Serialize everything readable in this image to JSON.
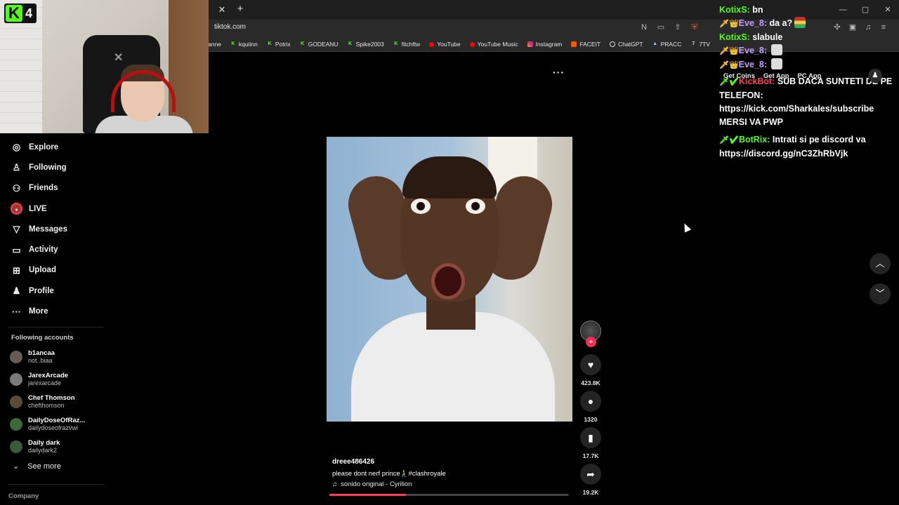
{
  "browser": {
    "url": "tiktok.com",
    "close_tab_glyph": "✕",
    "new_tab_glyph": "+",
    "bookmarks": [
      {
        "label": "anne",
        "icon": "none"
      },
      {
        "label": "kquiinn",
        "icon": "kick"
      },
      {
        "label": "Potrix",
        "icon": "kick"
      },
      {
        "label": "GODEANU",
        "icon": "kick"
      },
      {
        "label": "Spike2003",
        "icon": "kick"
      },
      {
        "label": "fitchftw",
        "icon": "kick"
      },
      {
        "label": "YouTube",
        "icon": "youtube"
      },
      {
        "label": "YouTube Music",
        "icon": "youtube"
      },
      {
        "label": "Instagram",
        "icon": "instagram"
      },
      {
        "label": "FACEIT",
        "icon": "faceit"
      },
      {
        "label": "ChatGPT",
        "icon": "chatgpt"
      },
      {
        "label": "PRACC",
        "icon": "pracc"
      },
      {
        "label": "7TV",
        "icon": "7tv"
      }
    ]
  },
  "overlay": {
    "kick_logo": "K",
    "kick_number": "4"
  },
  "sidebar": {
    "nav": [
      {
        "label": "Explore",
        "icon": "compass-icon",
        "glyph": "◎"
      },
      {
        "label": "Following",
        "icon": "person-icon",
        "glyph": "♙"
      },
      {
        "label": "Friends",
        "icon": "friends-icon",
        "glyph": "⚇"
      },
      {
        "label": "LIVE",
        "icon": "live-icon",
        "glyph": "●"
      },
      {
        "label": "Messages",
        "icon": "paper-plane-icon",
        "glyph": "▽"
      },
      {
        "label": "Activity",
        "icon": "inbox-icon",
        "glyph": "▭"
      },
      {
        "label": "Upload",
        "icon": "plus-square-icon",
        "glyph": "⊞"
      },
      {
        "label": "Profile",
        "icon": "profile-icon",
        "glyph": "♟"
      },
      {
        "label": "More",
        "icon": "ellipsis-icon",
        "glyph": "···"
      }
    ],
    "following_title": "Following accounts",
    "accounts": [
      {
        "name": "b1ancaa",
        "handle": "not..biaa"
      },
      {
        "name": "JarexArcade",
        "handle": "jarexarcade"
      },
      {
        "name": "Chef Thomson",
        "handle": "chefthomson"
      },
      {
        "name": "DailyDoseOfRaz...",
        "handle": "dailydoseofrazvwi"
      },
      {
        "name": "Daily dark",
        "handle": "dailydark2"
      }
    ],
    "see_more": "See more",
    "company": "Company"
  },
  "video": {
    "author": "dreee486426",
    "caption": "please dont nerf prince🧎‍♂️#clashroyale",
    "sound": "sonido original - Cyrilion",
    "progress": 0.32,
    "likes": "423.8K",
    "comments": "1320",
    "saves": "17.7K",
    "shares": "19.2K"
  },
  "chat": {
    "messages": [
      {
        "user": "KotixS:",
        "color": "green",
        "badges": "",
        "text": " bn"
      },
      {
        "user": "Eve_8:",
        "color": "purple",
        "badges": "🗡👑",
        "text": " da a?"
      },
      {
        "user": "KotixS:",
        "color": "green",
        "badges": "",
        "text": " slabule"
      },
      {
        "user": "Eve_8:",
        "color": "purple",
        "badges": "🗡👑",
        "text": ""
      },
      {
        "user": "Eve_8:",
        "color": "purple",
        "badges": "🗡👑",
        "text": ""
      },
      {
        "user": "KickBot:",
        "color": "red",
        "badges": "🗡✔",
        "text": " SUB DACA SUNTETI DE PE TELEFON: https://kick.com/Sharkales/subscribe MERSI VA PWP"
      },
      {
        "user": "BotRix:",
        "color": "green",
        "badges": "🗡✔",
        "text": " Intrati si pe discord va https://discord.gg/nC3ZhRbVjk"
      }
    ],
    "get_coins": "Get Coins",
    "get_app": "Get App",
    "pc_app": "PC App"
  }
}
